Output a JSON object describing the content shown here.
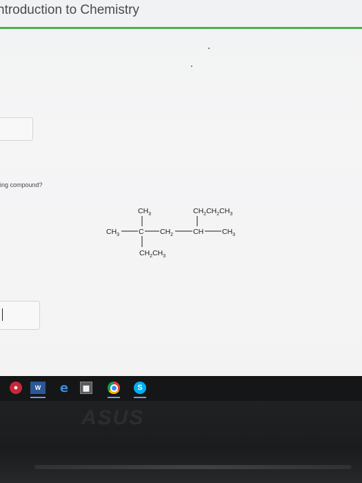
{
  "header": {
    "title": "ntroduction to Chemistry"
  },
  "question": {
    "text": "ing compound?"
  },
  "structure": {
    "top_left_branch": [
      "CH",
      "3"
    ],
    "top_right_branch": [
      "CH",
      "2",
      "CH",
      "2",
      "CH",
      "3"
    ],
    "main_chain": [
      "CH",
      "3",
      "C",
      "CH",
      "2",
      "CH",
      "CH",
      "3"
    ],
    "bottom_branch": [
      "CH",
      "2",
      "CH",
      "3"
    ]
  },
  "taskbar": {
    "icons": [
      "opera-icon",
      "word-icon",
      "edge-icon",
      "calculator-icon",
      "chrome-icon",
      "skype-icon"
    ],
    "word_label": "W",
    "edge_label": "e",
    "skype_label": "S"
  },
  "bezel": {
    "brand": "ASUS"
  },
  "colors": {
    "accent": "#4caf50",
    "taskbar": "#151618"
  }
}
